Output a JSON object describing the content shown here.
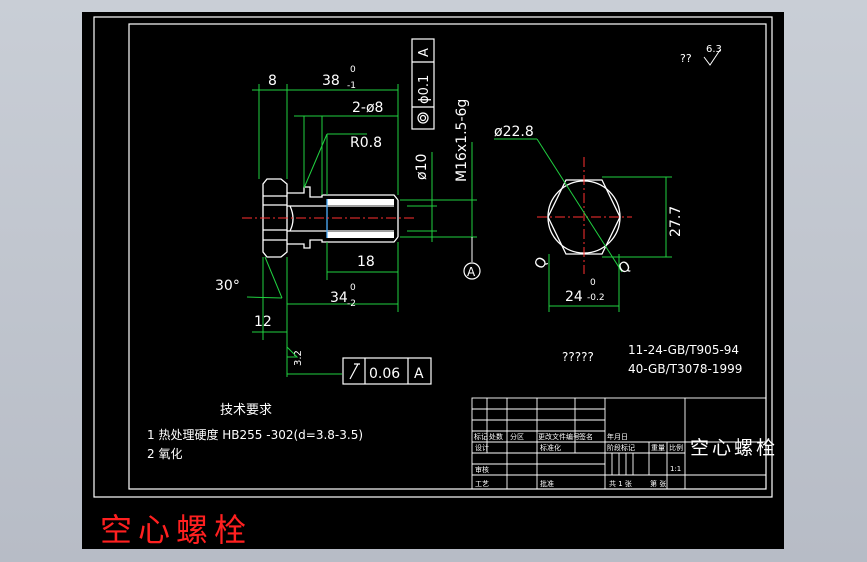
{
  "drawing": {
    "dimensions": {
      "head_len": "8",
      "body_len": "38",
      "body_len_upper": "0",
      "body_len_lower": "-1",
      "holes": "2-ø8",
      "radius": "R0.8",
      "bore": "ø10",
      "thread": "M16x1.5-6g",
      "thread_len": "18",
      "shank_len": "34",
      "shank_len_upper": "0",
      "shank_len_lower": "-2",
      "chamfer_angle": "30°",
      "head_offset": "12",
      "circumscribed": "ø22.8",
      "across_corners": "27.7",
      "across_flats": "24",
      "across_flats_upper": "0",
      "across_flats_lower": "-0.2",
      "surface_roughness_main": "3.2",
      "general_roughness_mark": "??",
      "general_roughness": "6.3"
    },
    "tolerances": {
      "position_value": "ϕ0.1",
      "position_datum": "A",
      "runout_value": "0.06",
      "runout_datum": "A",
      "datum_label": "A",
      "section_letter": "Q"
    },
    "notes": {
      "title": "技术要求",
      "item1": "1 热处理硬度 HB255 -302(d=3.8-3.5)",
      "item2": "2 氧化"
    },
    "standards": {
      "label": "?????",
      "line1": "11-24-GB/T905-94",
      "line2": "40-GB/T3078-1999"
    },
    "title_block": {
      "part_name": "空心螺栓",
      "h_mark": "标记",
      "h_count": "处数",
      "h_zone": "分区",
      "h_doc": "更改文件编号",
      "h_sign": "签名",
      "h_date": "年月日",
      "h_design": "设计",
      "h_std": "标准化",
      "h_stage": "阶段标记",
      "h_weight": "重量",
      "h_scale": "比例",
      "h_check": "审核",
      "h_process": "工艺",
      "h_approve": "批准",
      "scale_value": "1:1",
      "sheet_total": "共 1 张",
      "sheet_no": "第 张"
    }
  },
  "caption": "空心螺栓"
}
